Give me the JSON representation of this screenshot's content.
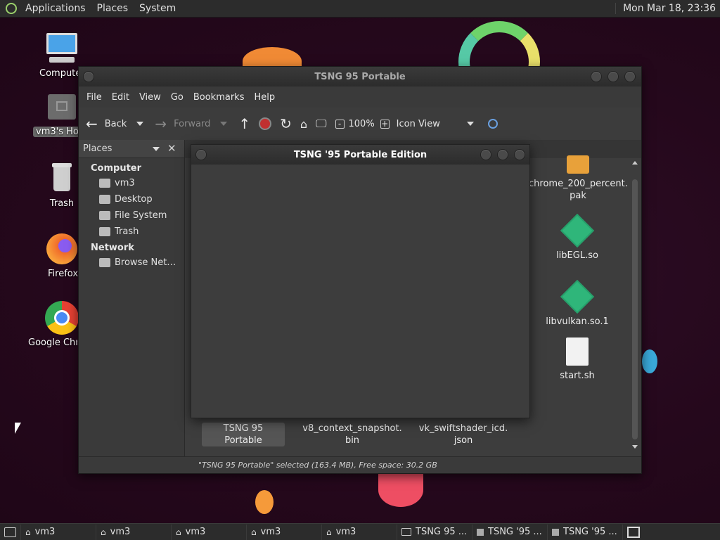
{
  "top_panel": {
    "menus": [
      "Applications",
      "Places",
      "System"
    ],
    "clock": "Mon Mar 18, 23:36"
  },
  "desktop_icons": [
    {
      "label": "Computer"
    },
    {
      "label": "vm3's Home"
    },
    {
      "label": "Trash"
    },
    {
      "label": "Firefox"
    },
    {
      "label": "Google Chrome"
    }
  ],
  "file_manager": {
    "title": "TSNG 95 Portable",
    "menubar": [
      "File",
      "Edit",
      "View",
      "Go",
      "Bookmarks",
      "Help"
    ],
    "toolbar": {
      "back": "Back",
      "forward": "Forward",
      "zoom": "100%",
      "view_mode": "Icon View"
    },
    "sidebar": {
      "header": "Places",
      "sections": [
        {
          "title": "Computer",
          "items": [
            "vm3",
            "Desktop",
            "File System",
            "Trash"
          ]
        },
        {
          "title": "Network",
          "items": [
            "Browse Net…"
          ]
        }
      ]
    },
    "files": [
      {
        "name": "chrome_200_percent.\npak",
        "icon": "folder-icon"
      },
      {
        "name": "libEGL.so",
        "icon": "library-icon"
      },
      {
        "name": "libvulkan.so.1",
        "icon": "library-icon"
      },
      {
        "name": "start.sh",
        "icon": "script-icon"
      },
      {
        "name": "TSNG 95 Portable",
        "icon": "executable-icon"
      },
      {
        "name": "v8_context_snapshot.\nbin",
        "icon": "file-icon"
      },
      {
        "name": "vk_swiftshader_icd.\njson",
        "icon": "file-icon"
      }
    ],
    "status": "\"TSNG 95 Portable\" selected (163.4 MB), Free space: 30.2 GB"
  },
  "inner_window": {
    "title": "TSNG '95 Portable Edition"
  },
  "taskbar": [
    {
      "label": "vm3"
    },
    {
      "label": "vm3"
    },
    {
      "label": "vm3"
    },
    {
      "label": "vm3"
    },
    {
      "label": "vm3"
    },
    {
      "label": "TSNG 95 ..."
    },
    {
      "label": "TSNG '95 ..."
    },
    {
      "label": "TSNG '95 ..."
    }
  ],
  "colors": {
    "panel": "#2c2c2c",
    "window": "#3c3c3c",
    "accent_green": "#2fb67a",
    "stop_red": "#c03030"
  }
}
